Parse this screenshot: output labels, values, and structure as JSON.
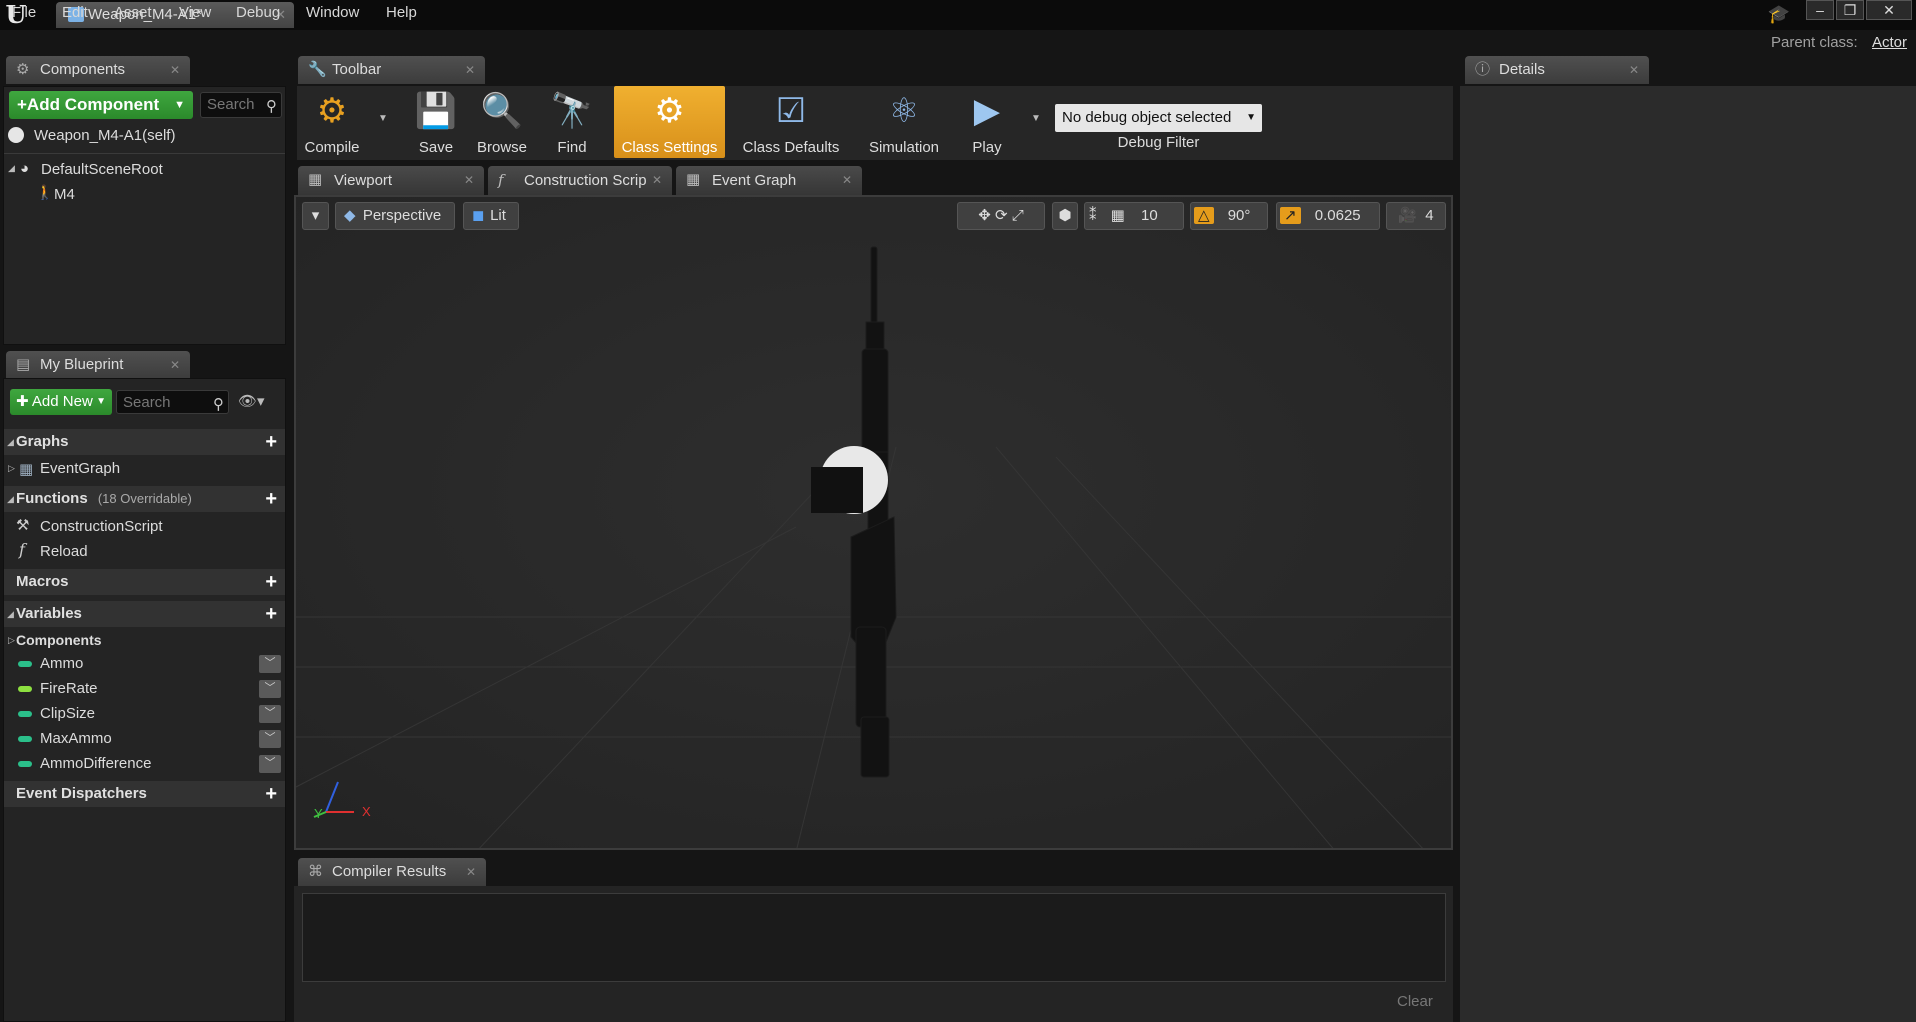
{
  "window": {
    "doc_tab": "Weapon_M4-A1*",
    "parent_class_label": "Parent class:",
    "parent_class_value": "Actor",
    "logo": "U"
  },
  "menu": [
    "File",
    "Edit",
    "Asset",
    "View",
    "Debug",
    "Window",
    "Help"
  ],
  "components": {
    "tab": "Components",
    "add_button": "+Add Component",
    "search_placeholder": "Search",
    "self_item": "Weapon_M4-A1(self)",
    "tree": [
      {
        "label": "DefaultSceneRoot"
      },
      {
        "label": "M4"
      }
    ]
  },
  "my_blueprint": {
    "tab": "My Blueprint",
    "add_button": "Add New",
    "search_placeholder": "Search",
    "graphs": {
      "title": "Graphs",
      "items": [
        "EventGraph"
      ]
    },
    "functions": {
      "title": "Functions",
      "sub": "(18 Overridable)",
      "items": [
        "ConstructionScript",
        "Reload"
      ]
    },
    "macros": {
      "title": "Macros"
    },
    "variables": {
      "title": "Variables",
      "group": "Components",
      "items": [
        {
          "name": "Ammo",
          "color": "#2bbf8a"
        },
        {
          "name": "FireRate",
          "color": "#8de040"
        },
        {
          "name": "ClipSize",
          "color": "#2bbf8a"
        },
        {
          "name": "MaxAmmo",
          "color": "#2bbf8a"
        },
        {
          "name": "AmmoDifference",
          "color": "#2bbf8a"
        }
      ]
    },
    "dispatchers": {
      "title": "Event Dispatchers"
    }
  },
  "toolbar": {
    "tab": "Toolbar",
    "buttons": {
      "compile": "Compile",
      "save": "Save",
      "browse": "Browse",
      "find": "Find",
      "class_settings": "Class Settings",
      "class_defaults": "Class Defaults",
      "simulation": "Simulation",
      "play": "Play"
    },
    "debug_select": "No debug object selected",
    "debug_label": "Debug Filter"
  },
  "editor_tabs": [
    "Viewport",
    "Construction Scrip",
    "Event Graph"
  ],
  "viewport": {
    "perspective": "Perspective",
    "lit": "Lit",
    "grid_snap": "10",
    "rotation_snap": "90°",
    "scale_snap": "0.0625",
    "camera_speed": "4",
    "axis_x": "X",
    "axis_y": "Y"
  },
  "details": {
    "tab": "Details"
  },
  "compiler": {
    "tab": "Compiler Results",
    "clear": "Clear"
  },
  "colors": {
    "accent_orange": "#e59c1b",
    "add_green": "#2f9a2f"
  }
}
